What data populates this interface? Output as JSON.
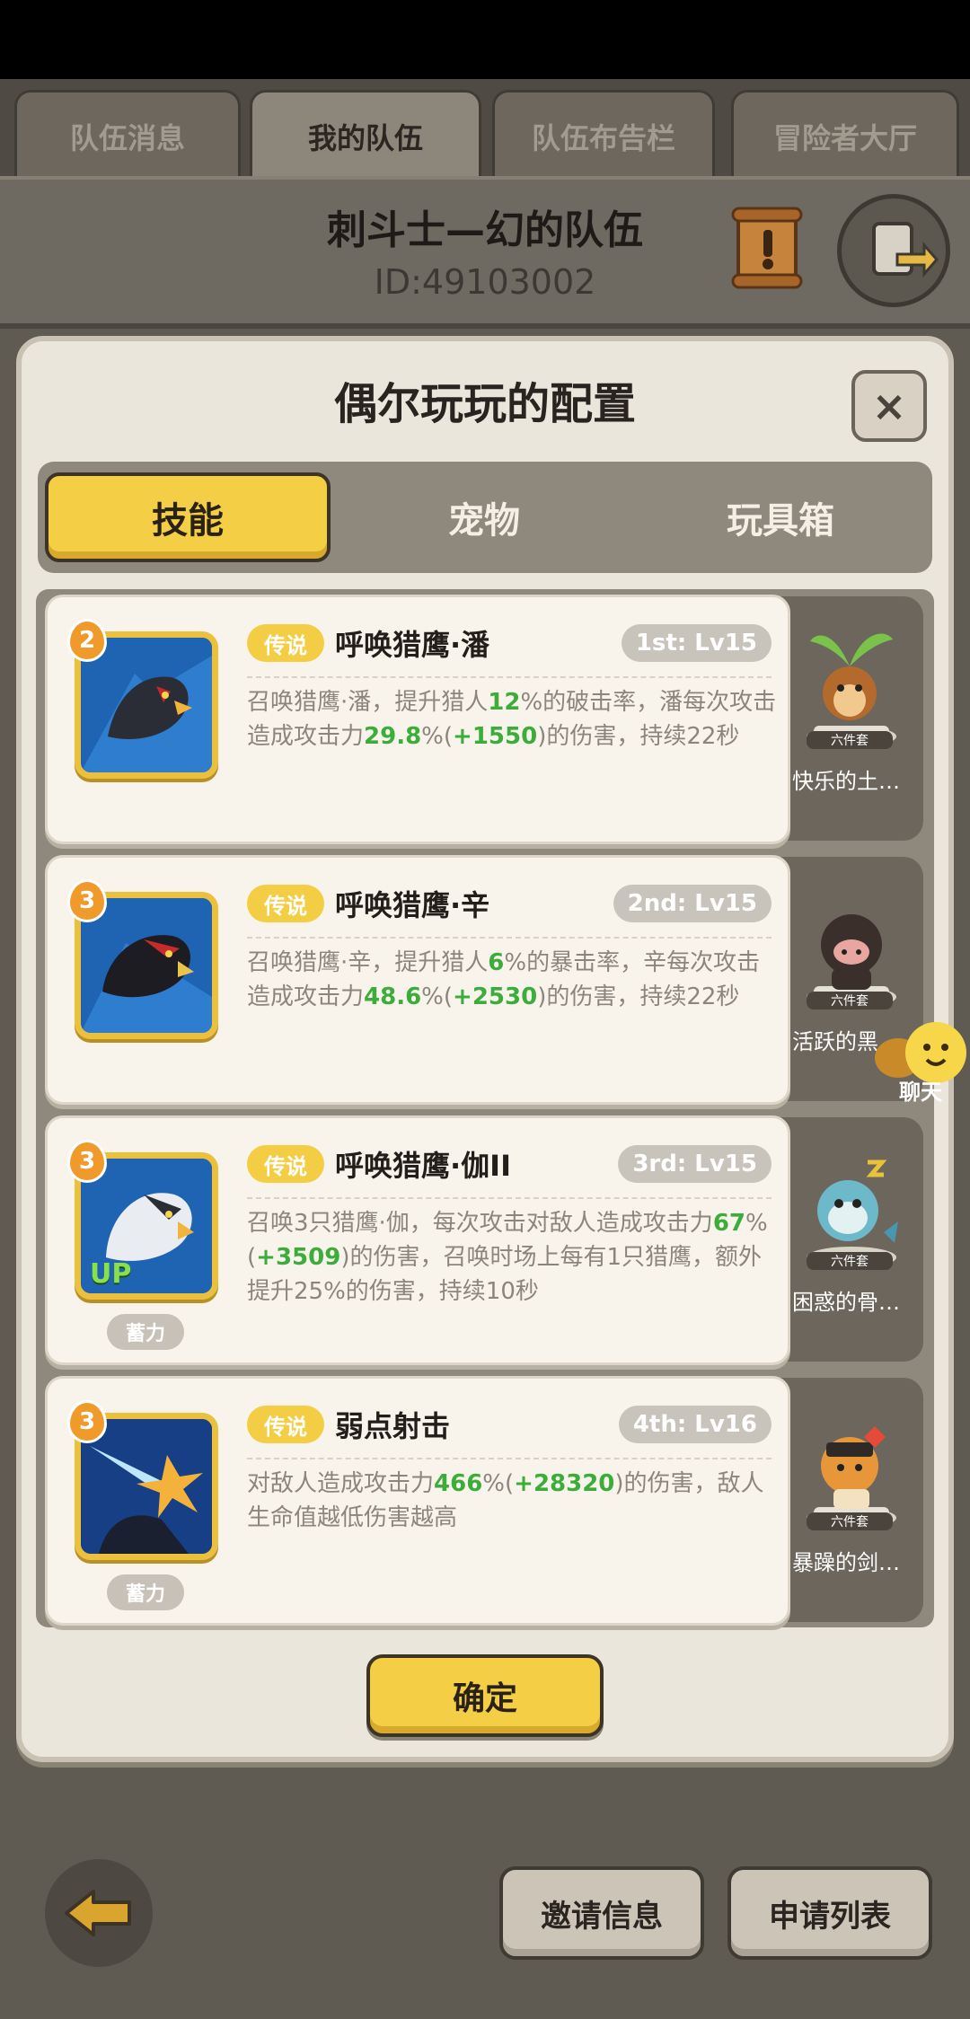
{
  "top_tabs": [
    {
      "label": "队伍消息"
    },
    {
      "label": "我的队伍"
    },
    {
      "label": "队伍布告栏"
    },
    {
      "label": "冒险者大厅"
    }
  ],
  "team": {
    "name": "刺斗士—幻的队伍",
    "id": "ID:49103002"
  },
  "dialog": {
    "title": "偶尔玩玩的配置",
    "close": "×",
    "tabs": [
      {
        "label": "技能"
      },
      {
        "label": "宠物"
      },
      {
        "label": "玩具箱"
      }
    ],
    "confirm": "确定"
  },
  "skills": [
    {
      "badge": "2",
      "tag": "传说",
      "name": "呼唤猎鹰·潘",
      "level": "1st: Lv15",
      "desc": [
        {
          "t": "召唤猎鹰·潘，提升猎人"
        },
        {
          "t": "12",
          "hl": true
        },
        {
          "t": "%的破击率，潘每次攻击造成攻击力"
        },
        {
          "t": "29.8",
          "hl": true
        },
        {
          "t": "%("
        },
        {
          "t": "+1550",
          "hl": true
        },
        {
          "t": ")的伤害，持续22秒"
        }
      ],
      "charge": ""
    },
    {
      "badge": "3",
      "tag": "传说",
      "name": "呼唤猎鹰·辛",
      "level": "2nd: Lv15",
      "desc": [
        {
          "t": "召唤猎鹰·辛，提升猎人"
        },
        {
          "t": "6",
          "hl": true
        },
        {
          "t": "%的暴击率，辛每次攻击造成攻击力"
        },
        {
          "t": "48.6",
          "hl": true
        },
        {
          "t": "%("
        },
        {
          "t": "+2530",
          "hl": true
        },
        {
          "t": ")的伤害，持续22秒"
        }
      ],
      "charge": ""
    },
    {
      "badge": "3",
      "tag": "传说",
      "name": "呼唤猎鹰·伽II",
      "level": "3rd: Lv15",
      "desc": [
        {
          "t": "召唤3只猎鹰·伽，每次攻击对敌人造成攻击力"
        },
        {
          "t": "67",
          "hl": true
        },
        {
          "t": "%("
        },
        {
          "t": "+3509",
          "hl": true
        },
        {
          "t": ")的伤害，召唤时场上每有1只猎鹰，额外提升25%的伤害，持续10秒"
        }
      ],
      "charge": "蓄力",
      "up": "UP"
    },
    {
      "badge": "3",
      "tag": "传说",
      "name": "弱点射击",
      "level": "4th: Lv16",
      "desc": [
        {
          "t": "对敌人造成攻击力"
        },
        {
          "t": "466",
          "hl": true
        },
        {
          "t": "%("
        },
        {
          "t": "+28320",
          "hl": true
        },
        {
          "t": ")的伤害，敌人生命值越低伤害越高"
        }
      ],
      "charge": "蓄力"
    }
  ],
  "pets": [
    {
      "name": "快乐的土…",
      "set": "六件套"
    },
    {
      "name": "活跃的黑",
      "set": "六件套"
    },
    {
      "name": "困惑的骨…",
      "set": "六件套"
    },
    {
      "name": "暴躁的剑…",
      "set": "六件套"
    }
  ],
  "chat_label": "聊天",
  "bottom": {
    "invite": "邀请信息",
    "applications": "申请列表"
  }
}
